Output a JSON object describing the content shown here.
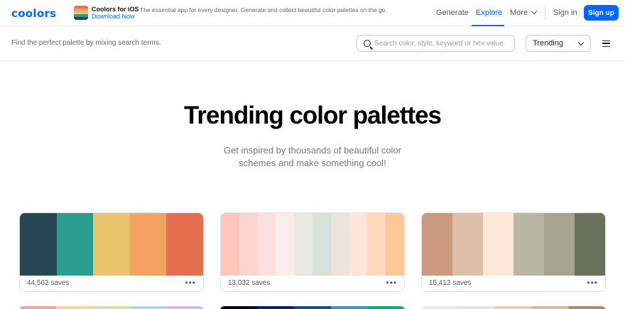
{
  "header": {
    "logo": "coolors",
    "promo": {
      "title": "Coolors for iOS",
      "description": "The essential app for every designer. Generate and collect beautiful color palettes on the go.",
      "link": "Download Now"
    },
    "nav": {
      "generate": "Generate",
      "explore": "Explore",
      "more": "More",
      "signin": "Sign in",
      "signup": "Sign up"
    }
  },
  "toolbar": {
    "hint": "Find the perfect palette by mixing search terms.",
    "search_placeholder": "Search color, style, keyword or hex value",
    "sort_value": "Trending"
  },
  "hero": {
    "title": "Trending color palettes",
    "subtitle": "Get inspired by thousands of beautiful color schemes and make something cool!"
  },
  "palettes": [
    {
      "saves": "44,562 saves",
      "colors": [
        "#264653",
        "#2a9d8f",
        "#e9c46a",
        "#f4a261",
        "#e76f51"
      ]
    },
    {
      "saves": "13,032 saves",
      "colors": [
        "#fec5bb",
        "#fcd5ce",
        "#fae1dd",
        "#f8edeb",
        "#e8e8e4",
        "#d8e2dc",
        "#ece4db",
        "#ffe5d9",
        "#ffd7ba",
        "#fec89a"
      ]
    },
    {
      "saves": "15,412 saves",
      "colors": [
        "#cb997e",
        "#ddbea9",
        "#ffe8d6",
        "#b7b7a4",
        "#a5a58d",
        "#6b705c"
      ]
    }
  ],
  "peek_rows": [
    {
      "colors": [
        "#f4a4a4",
        "#f6d6a0",
        "#c9e8b0",
        "#a8d8ea",
        "#d7b8e8"
      ]
    },
    {
      "colors": [
        "#03071e",
        "#0a2463",
        "#1b4d89",
        "#3e92cc",
        "#0ead69"
      ]
    },
    {
      "colors": [
        "#f1e6db",
        "#ede0d4",
        "#e6ccb2",
        "#ddb892",
        "#b08968"
      ]
    }
  ]
}
